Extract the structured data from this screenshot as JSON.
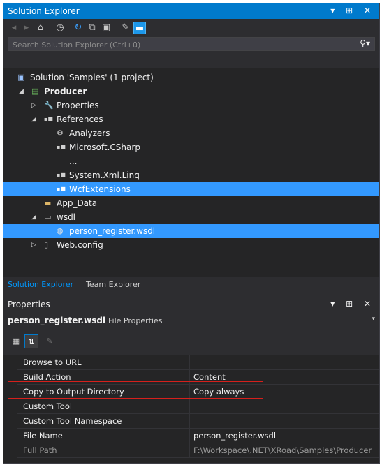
{
  "solution_explorer": {
    "title": "Solution Explorer",
    "window_controls": "▾ ⊞ ✕",
    "search_placeholder": "Search Solution Explorer (Ctrl+ü)",
    "search_icon": "⚲▾",
    "toolbar_icons": [
      "back-icon",
      "forward-icon",
      "home-icon",
      "sync-icon",
      "refresh-icon",
      "collapse-all-icon",
      "show-all-files-icon",
      "properties-icon",
      "preview-icon"
    ],
    "tree": [
      {
        "label": "Solution 'Samples' (1 project)",
        "icon": "▣",
        "arrow": "",
        "level": 0,
        "selected": false,
        "bold": false
      },
      {
        "label": "Producer",
        "icon": "▤",
        "arrow": "◢",
        "level": 0,
        "selected": false,
        "bold": true
      },
      {
        "label": "Properties",
        "icon": "🔧",
        "arrow": "▷",
        "level": 1,
        "selected": false,
        "bold": false
      },
      {
        "label": "References",
        "icon": "▪■",
        "arrow": "◢",
        "level": 1,
        "selected": false,
        "bold": false
      },
      {
        "label": "Analyzers",
        "icon": "⚙",
        "arrow": "",
        "level": 2,
        "selected": false,
        "bold": false
      },
      {
        "label": "Microsoft.CSharp",
        "icon": "▪■",
        "arrow": "",
        "level": 2,
        "selected": false,
        "bold": false
      },
      {
        "label": "...",
        "icon": "",
        "arrow": "",
        "level": 2,
        "selected": false,
        "bold": false
      },
      {
        "label": "System.Xml.Linq",
        "icon": "▪■",
        "arrow": "",
        "level": 2,
        "selected": false,
        "bold": false
      },
      {
        "label": "WcfExtensions",
        "icon": "▪■",
        "arrow": "",
        "level": 2,
        "selected": true,
        "bold": false
      },
      {
        "label": "App_Data",
        "icon": "▬",
        "arrow": "",
        "level": 1,
        "selected": false,
        "bold": false
      },
      {
        "label": "wsdl",
        "icon": "▭",
        "arrow": "◢",
        "level": 1,
        "selected": false,
        "bold": false
      },
      {
        "label": "person_register.wsdl",
        "icon": "◍",
        "arrow": "",
        "level": 2,
        "selected": true,
        "bold": false
      },
      {
        "label": "Web.config",
        "icon": "▯",
        "arrow": "▷",
        "level": 1,
        "selected": false,
        "bold": false
      }
    ],
    "tabs": [
      "Solution Explorer",
      "Team Explorer"
    ]
  },
  "properties": {
    "title": "Properties",
    "window_controls": "▾ ⊞ ✕",
    "object_name": "person_register.wsdl",
    "object_kind": "File Properties",
    "dropdown": "▾",
    "toolbar_icons": [
      "categorized-icon",
      "alphabetical-icon",
      "property-pages-icon"
    ],
    "rows": [
      {
        "key": "Browse to URL",
        "value": "",
        "dim": false
      },
      {
        "key": "Build Action",
        "value": "Content",
        "dim": false
      },
      {
        "key": "Copy to Output Directory",
        "value": "Copy always",
        "dim": false
      },
      {
        "key": "Custom Tool",
        "value": "",
        "dim": false
      },
      {
        "key": "Custom Tool Namespace",
        "value": "",
        "dim": false
      },
      {
        "key": "File Name",
        "value": "person_register.wsdl",
        "dim": false
      },
      {
        "key": "Full Path",
        "value": "F:\\Workspace\\.NET\\XRoad\\Samples\\Producer",
        "dim": true
      }
    ]
  },
  "colors": {
    "accent": "#007acc",
    "selection": "#3399ff",
    "highlight_line": "#d6201c",
    "panel_bg": "#252526",
    "chrome_bg": "#2d2d30"
  }
}
